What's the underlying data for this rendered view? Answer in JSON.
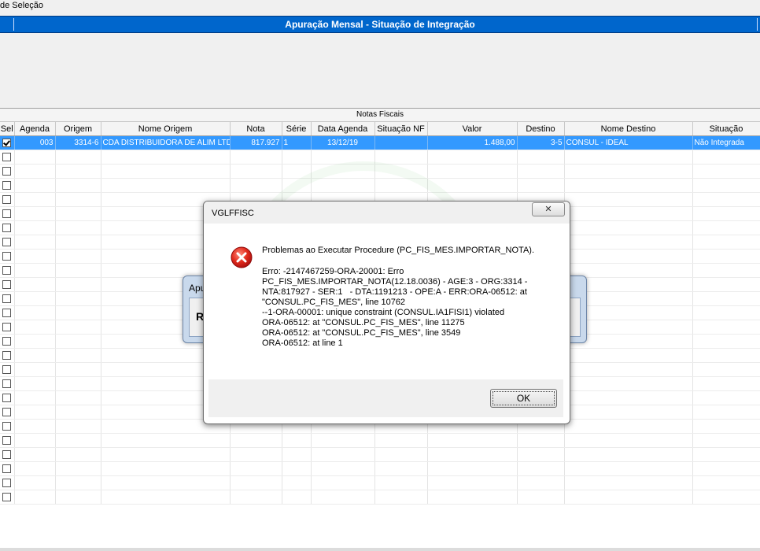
{
  "window": {
    "selection_label": "de Seleção",
    "banner_title": "Apuração Mensal - Situação de Integração"
  },
  "grid": {
    "group_title": "Notas Fiscais",
    "columns": [
      "Sel",
      "Agenda",
      "Origem",
      "Nome Origem",
      "Nota",
      "Série",
      "Data Agenda",
      "Situação NF",
      "Valor",
      "Destino",
      "Nome Destino",
      "Situação"
    ],
    "selected_row": {
      "sel": true,
      "agenda": "003",
      "origem": "3314-6",
      "nome_origem": "CDA DISTRIBUIDORA DE ALIM LTD",
      "nota": "817.927",
      "serie": "1",
      "data_agenda": "13/12/19",
      "situacao_nf": "",
      "valor": "1.488,00",
      "destino": "3-5",
      "nome_destino": "CONSUL - IDEAL",
      "situacao": "Não Integrada"
    },
    "empty_rows": 25
  },
  "background_dialog": {
    "title": "Apu",
    "text": "R"
  },
  "error_dialog": {
    "title": "VGLFFISC",
    "close_label": "✕",
    "headline": "Problemas ao Executar Procedure (PC_FIS_MES.IMPORTAR_NOTA).",
    "lines": [
      "Erro: -2147467259-ORA-20001: Erro",
      "PC_FIS_MES.IMPORTAR_NOTA(12.18.0036) - AGE:3 - ORG:3314 -",
      "NTA:817927 - SER:1   - DTA:1191213 - OPE:A - ERR:ORA-06512: at",
      "\"CONSUL.PC_FIS_MES\", line 10762",
      "--1-ORA-00001: unique constraint (CONSUL.IA1FISI1) violated",
      "ORA-06512: at \"CONSUL.PC_FIS_MES\", line 11275",
      "ORA-06512: at \"CONSUL.PC_FIS_MES\", line 3549",
      "ORA-06512: at line 1"
    ],
    "ok_label": "OK",
    "icon": "error-icon",
    "icon_color": "#d32020"
  },
  "colors": {
    "banner": "#0066cc",
    "selected_row": "#3399ff"
  }
}
